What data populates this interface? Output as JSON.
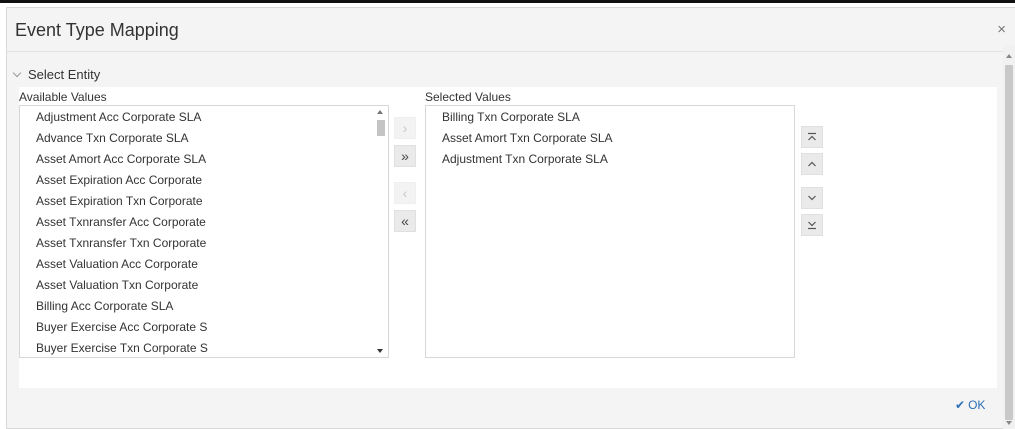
{
  "dialog": {
    "title": "Event Type Mapping",
    "close_glyph": "×"
  },
  "section": {
    "title": "Select Entity"
  },
  "available": {
    "label": "Available Values",
    "items": [
      "Adjustment Acc Corporate SLA",
      "Advance Txn Corporate SLA",
      "Asset Amort Acc Corporate SLA",
      "Asset Expiration Acc Corporate",
      "Asset Expiration Txn Corporate",
      "Asset Txnransfer Acc Corporate",
      "Asset Txnransfer Txn Corporate",
      "Asset Valuation Acc Corporate",
      "Asset Valuation Txn Corporate",
      "Billing Acc Corporate SLA",
      "Buyer Exercise Acc Corporate S",
      "Buyer Exercise Txn Corporate S"
    ]
  },
  "selected": {
    "label": "Selected Values",
    "items": [
      "Billing Txn Corporate SLA",
      "Asset Amort Txn Corporate SLA",
      "Adjustment Txn Corporate SLA"
    ]
  },
  "shuttle": {
    "move_one": "›",
    "move_all": "»",
    "remove_one": "‹",
    "remove_all": "«"
  },
  "order": {
    "top": "⌅",
    "up": "⌃",
    "down": "⌄",
    "bottom": "⌆"
  },
  "footer": {
    "ok_label": "OK",
    "ok_icon": "checkmark-icon"
  }
}
